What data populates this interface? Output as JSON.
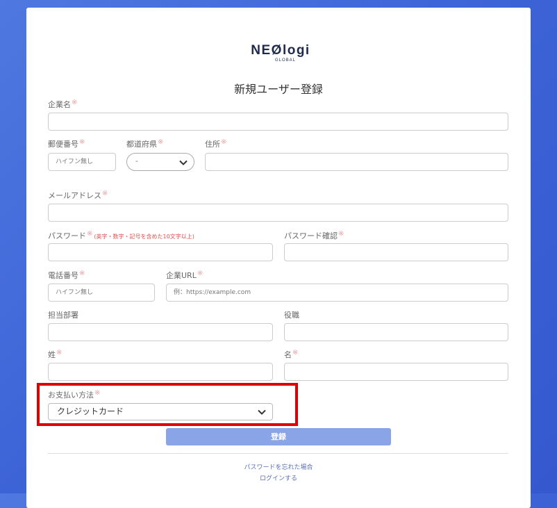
{
  "logo": {
    "main": "NEØlogi",
    "sub": "GLOBAL"
  },
  "page_title": "新規ユーザー登録",
  "required_mark": "※",
  "fields": {
    "company_name": {
      "label": "企業名",
      "value": ""
    },
    "postal_code": {
      "label": "郵便番号",
      "placeholder": "ハイフン無し"
    },
    "prefecture": {
      "label": "都道府県",
      "value": "-"
    },
    "address": {
      "label": "住所",
      "value": ""
    },
    "email": {
      "label": "メールアドレス",
      "value": ""
    },
    "password": {
      "label": "パスワード",
      "note": "(英字・数字・記号を含めた10文字以上)",
      "value": ""
    },
    "password_confirm": {
      "label": "パスワード確認",
      "value": ""
    },
    "phone": {
      "label": "電話番号",
      "placeholder": "ハイフン無し"
    },
    "company_url": {
      "label": "企業URL",
      "placeholder": "例：https://example.com"
    },
    "department": {
      "label": "担当部署",
      "value": ""
    },
    "position": {
      "label": "役職",
      "value": ""
    },
    "last_name": {
      "label": "姓",
      "value": ""
    },
    "first_name": {
      "label": "名",
      "value": ""
    },
    "payment_method": {
      "label": "お支払い方法",
      "value": "クレジットカード"
    }
  },
  "submit_label": "登録",
  "links": {
    "forgot_password": "パスワードを忘れた場合",
    "login": "ログインする"
  },
  "colors": {
    "background": "#3f66d8",
    "submit": "#8aa4e8",
    "highlight": "#e00000",
    "required": "#e8a0a0",
    "note": "#e05050",
    "link": "#5a6fb8"
  }
}
